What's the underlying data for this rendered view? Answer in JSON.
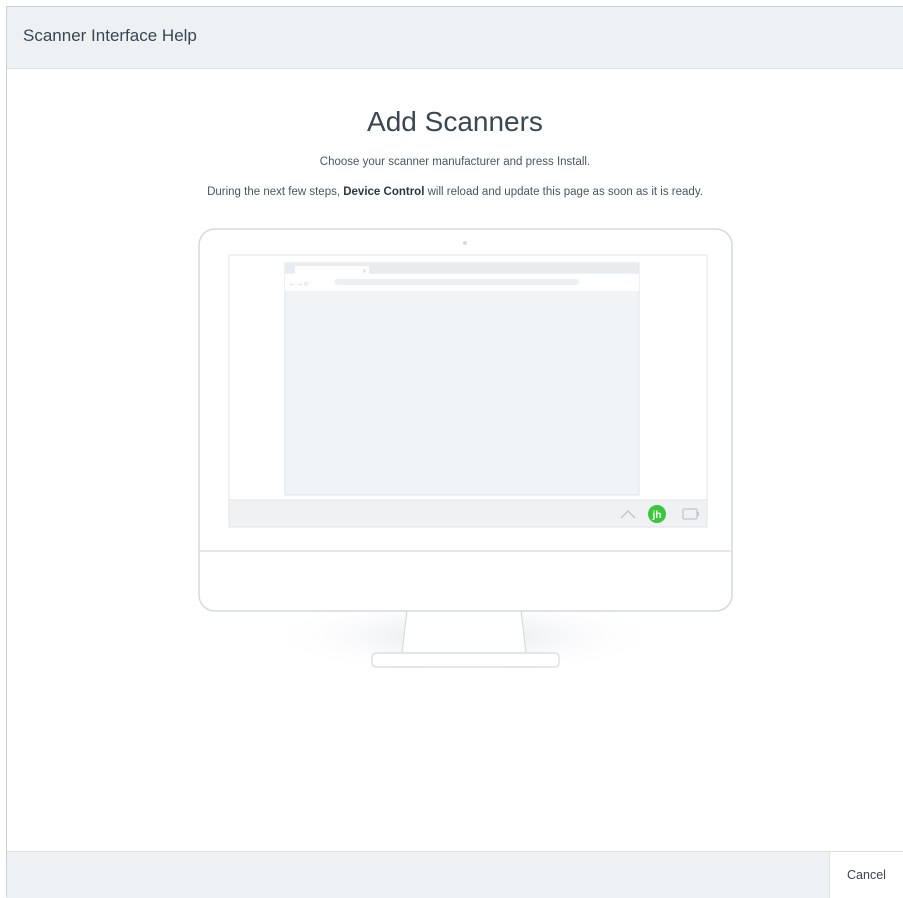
{
  "header": {
    "title": "Scanner Interface Help"
  },
  "main": {
    "title": "Add Scanners",
    "subtitle": "Choose your scanner manufacturer and press Install.",
    "info_prefix": "During the next few steps, ",
    "info_bold": "Device Control",
    "info_suffix": " will reload and update this page as soon as it is ready."
  },
  "illustration": {
    "tray_badge_text": "jh",
    "tray_icon": "jh-tray-icon",
    "chevron_icon": "chevron-up-icon",
    "battery_icon": "battery-icon",
    "accent_color": "#3cc63c"
  },
  "footer": {
    "cancel_label": "Cancel"
  }
}
